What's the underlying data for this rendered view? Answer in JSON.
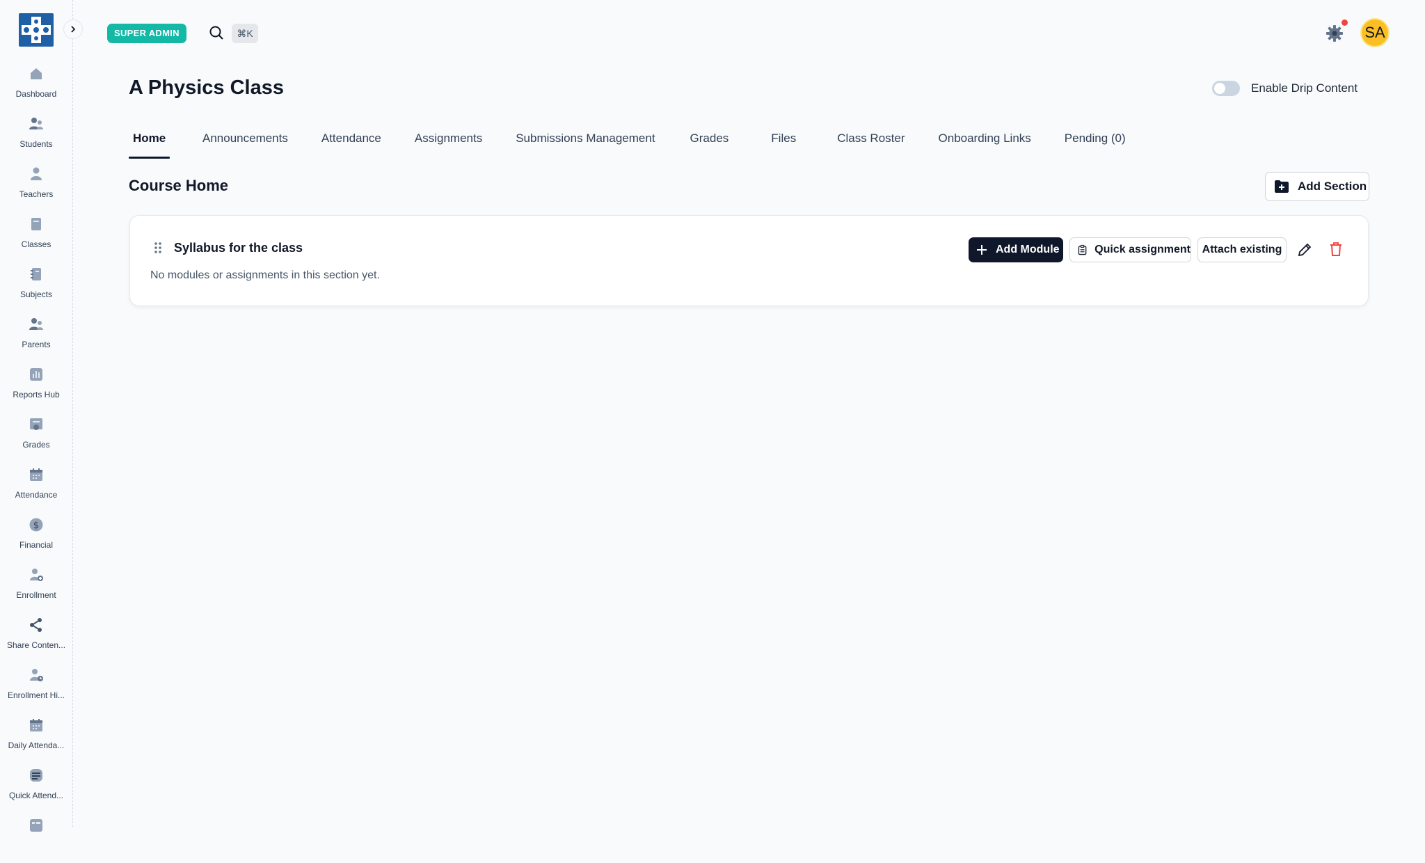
{
  "sidebar": {
    "items": [
      {
        "label": "Dashboard",
        "icon": "home-icon"
      },
      {
        "label": "Students",
        "icon": "students-icon"
      },
      {
        "label": "Teachers",
        "icon": "teacher-icon"
      },
      {
        "label": "Classes",
        "icon": "book-icon"
      },
      {
        "label": "Subjects",
        "icon": "notebook-icon"
      },
      {
        "label": "Parents",
        "icon": "parents-icon"
      },
      {
        "label": "Reports Hub",
        "icon": "chart-icon"
      },
      {
        "label": "Grades",
        "icon": "grades-icon"
      },
      {
        "label": "Attendance",
        "icon": "calendar-icon"
      },
      {
        "label": "Financial",
        "icon": "dollar-icon"
      },
      {
        "label": "Enrollment",
        "icon": "user-add-icon"
      },
      {
        "label": "Share Conten...",
        "icon": "share-icon"
      },
      {
        "label": "Enrollment Hi...",
        "icon": "user-history-icon"
      },
      {
        "label": "Daily Attenda...",
        "icon": "calendar-icon"
      },
      {
        "label": "Quick Attend...",
        "icon": "quick-attendance-icon"
      }
    ]
  },
  "topbar": {
    "role_badge": "SUPER ADMIN",
    "shortcut": "⌘K",
    "avatar_initials": "SA"
  },
  "page": {
    "title": "A Physics Class",
    "drip_label": "Enable Drip Content",
    "drip_enabled": false
  },
  "tabs": [
    {
      "label": "Home",
      "active": true
    },
    {
      "label": "Announcements"
    },
    {
      "label": "Attendance"
    },
    {
      "label": "Assignments"
    },
    {
      "label": "Submissions Management"
    },
    {
      "label": "Grades"
    },
    {
      "label": "Files"
    },
    {
      "label": "Class Roster"
    },
    {
      "label": "Onboarding Links"
    },
    {
      "label": "Pending (0)"
    }
  ],
  "course_home": {
    "heading": "Course Home",
    "add_section_label": "Add Section",
    "sections": [
      {
        "title": "Syllabus for the class",
        "empty_text": "No modules or assignments in this section yet.",
        "add_module_label": "Add Module",
        "quick_assignment_label": "Quick assignment",
        "attach_existing_label": "Attach existing"
      }
    ]
  },
  "colors": {
    "brand": "#1f5fa6",
    "badge": "#14b8a6",
    "primary_button": "#0f172a",
    "danger": "#ef4444",
    "avatar": "#fbbf24"
  }
}
